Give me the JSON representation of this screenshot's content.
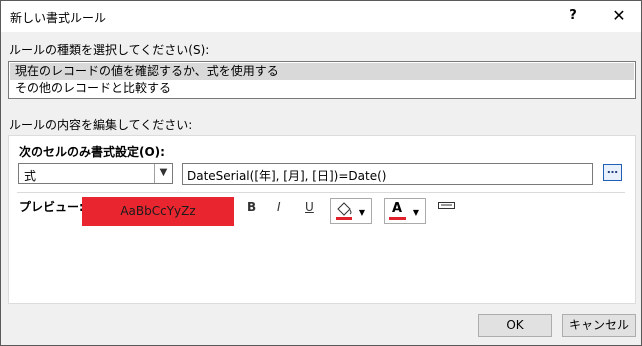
{
  "dialog": {
    "title": "新しい書式ルール",
    "help_label": "?",
    "close_label": "✕"
  },
  "rule_type": {
    "label": "ルールの種類を選択してください(S):",
    "items": [
      "現在のレコードの値を確認するか、式を使用する",
      "その他のレコードと比較する"
    ],
    "selected_index": 0
  },
  "rule_content": {
    "label": "ルールの内容を編集してください:",
    "condition_label": "次のセルのみ書式設定(O):",
    "condition_combo_value": "式",
    "formula_value": "DateSerial([年], [月], [日])=Date()",
    "ref_button_label": "…",
    "preview_label": "プレビュー:",
    "preview_text": "AaBbCcYyZz",
    "bold_label": "B",
    "italic_label": "I",
    "underline_label": "U",
    "fill_icon": "fill-bucket-icon",
    "font_color_label": "A",
    "enable_icon": "enable-toggle-icon",
    "preview_bg": "#e9262f",
    "accent_red": "#e0202a"
  },
  "buttons": {
    "ok": "OK",
    "cancel": "キャンセル"
  }
}
